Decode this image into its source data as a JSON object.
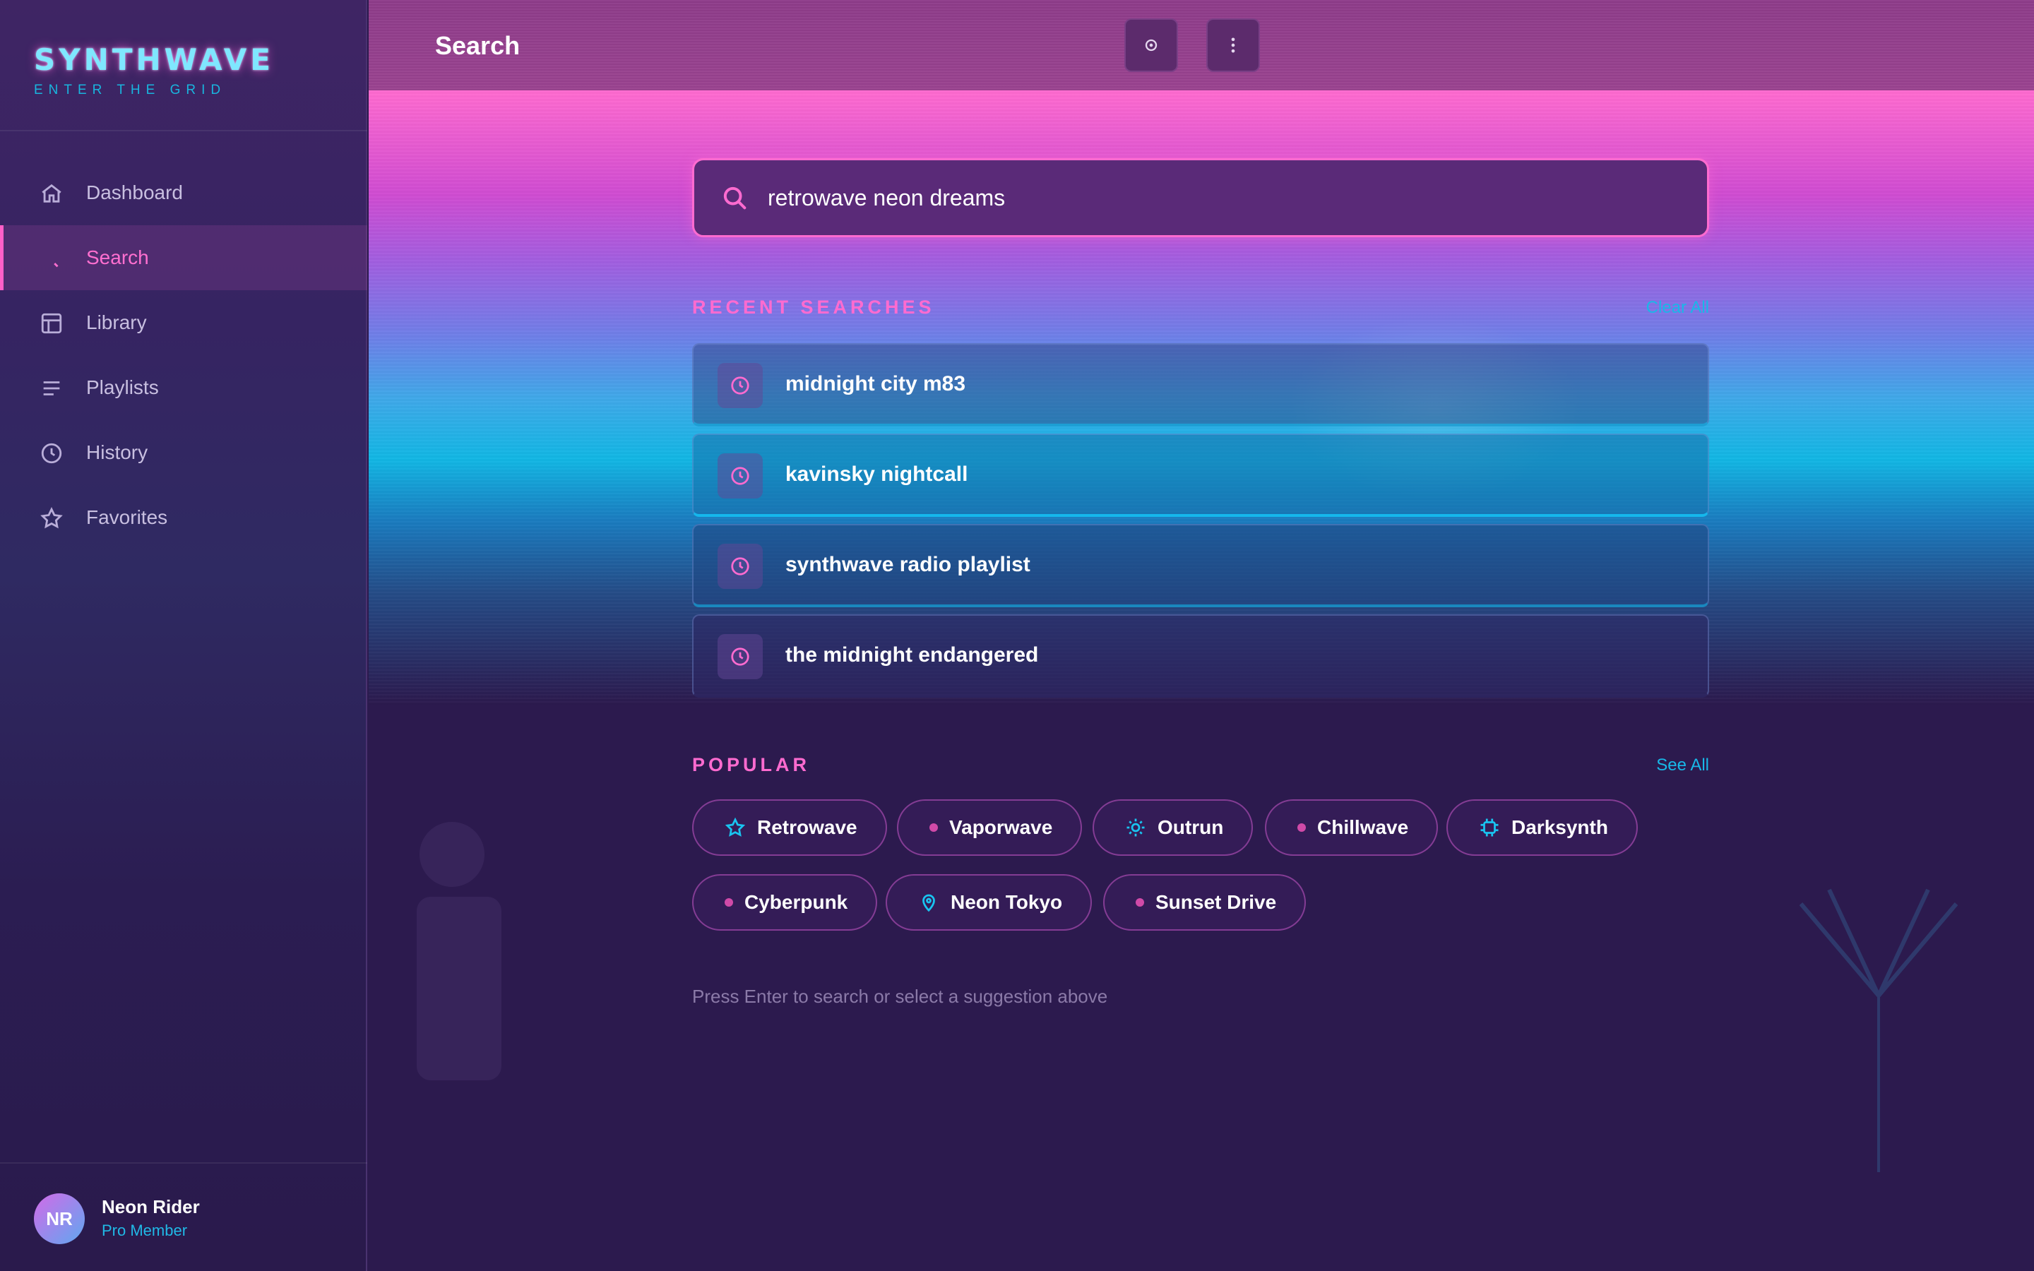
{
  "brand": {
    "title": "SYNTHWAVE",
    "subtitle": "ENTER THE GRID"
  },
  "sidebar": {
    "items": [
      {
        "label": "Dashboard",
        "icon": "home-icon"
      },
      {
        "label": "Search",
        "icon": "search-icon",
        "active": true
      },
      {
        "label": "Library",
        "icon": "library-icon"
      },
      {
        "label": "Playlists",
        "icon": "list-icon"
      },
      {
        "label": "History",
        "icon": "clock-icon"
      },
      {
        "label": "Favorites",
        "icon": "star-icon"
      }
    ]
  },
  "user": {
    "initials": "NR",
    "name": "Neon Rider",
    "role": "Pro Member"
  },
  "header": {
    "title": "Search"
  },
  "search": {
    "value": "retrowave neon dreams"
  },
  "recent": {
    "heading": "RECENT SEARCHES",
    "clear_label": "Clear All",
    "items": [
      "midnight city m83",
      "kavinsky nightcall",
      "synthwave radio playlist",
      "the midnight endangered"
    ]
  },
  "popular": {
    "heading": "POPULAR",
    "see_all_label": "See All",
    "chips": [
      {
        "label": "Retrowave",
        "icon": "star-icon"
      },
      {
        "label": "Vaporwave",
        "icon": "dot"
      },
      {
        "label": "Outrun",
        "icon": "sun-icon"
      },
      {
        "label": "Chillwave",
        "icon": "dot"
      },
      {
        "label": "Darksynth",
        "icon": "chip-icon"
      },
      {
        "label": "Cyberpunk",
        "icon": "dot"
      },
      {
        "label": "Neon Tokyo",
        "icon": "location-pin-icon"
      },
      {
        "label": "Sunset Drive",
        "icon": "dot"
      }
    ]
  },
  "hint": "Press Enter to search or select a suggestion above",
  "colors": {
    "accent": "#ff6bd0",
    "cyan": "#18b8e8",
    "background": "#2c1a4e"
  }
}
